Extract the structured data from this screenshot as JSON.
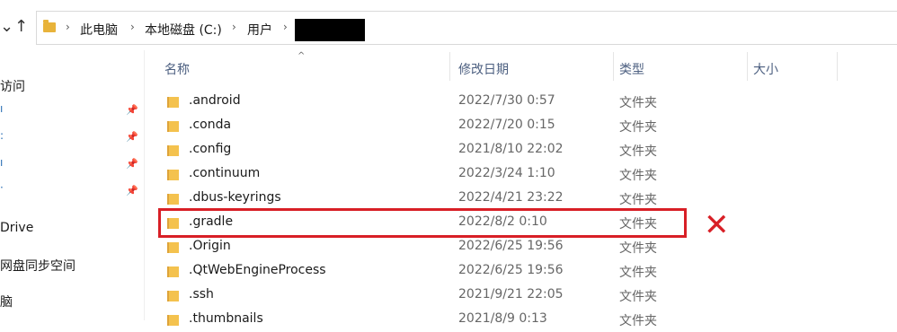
{
  "nav": {
    "back": "←",
    "forward": "→",
    "dropdown": "⌄",
    "up": "↑"
  },
  "breadcrumb": {
    "items": [
      "此电脑",
      "本地磁盘 (C:)",
      "用户"
    ],
    "separator": "›"
  },
  "leftnav": {
    "items": [
      "访问",
      "Drive",
      "网盘同步空间",
      "脑"
    ],
    "pin": "📌"
  },
  "columns": {
    "name": "名称",
    "date": "修改日期",
    "type": "类型",
    "size": "大小",
    "sort_indicator": "^"
  },
  "rows": [
    {
      "name": ".android",
      "date": "2022/7/30 0:57",
      "type": "文件夹"
    },
    {
      "name": ".conda",
      "date": "2022/7/20 0:15",
      "type": "文件夹"
    },
    {
      "name": ".config",
      "date": "2021/8/10 22:02",
      "type": "文件夹"
    },
    {
      "name": ".continuum",
      "date": "2022/3/24 1:10",
      "type": "文件夹"
    },
    {
      "name": ".dbus-keyrings",
      "date": "2022/4/21 23:22",
      "type": "文件夹"
    },
    {
      "name": ".gradle",
      "date": "2022/8/2 0:10",
      "type": "文件夹"
    },
    {
      "name": ".Origin",
      "date": "2022/6/25 19:56",
      "type": "文件夹"
    },
    {
      "name": ".QtWebEngineProcess",
      "date": "2022/6/25 19:56",
      "type": "文件夹"
    },
    {
      "name": ".ssh",
      "date": "2021/9/21 22:05",
      "type": "文件夹"
    },
    {
      "name": ".thumbnails",
      "date": "2021/8/9 0:13",
      "type": "文件夹"
    }
  ],
  "annotation": {
    "mark": "✕",
    "color": "#d81f26"
  }
}
